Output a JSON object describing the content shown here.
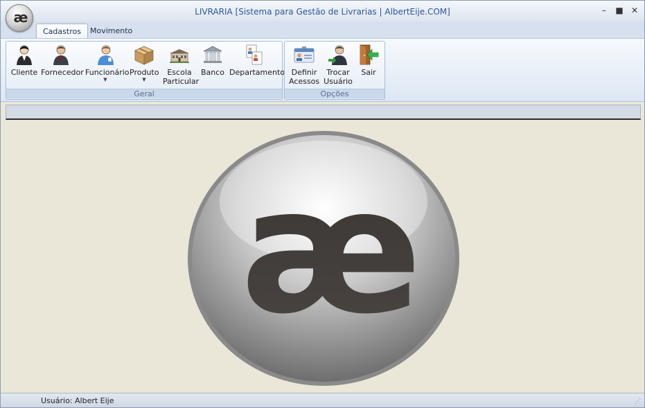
{
  "window": {
    "title": "LIVRARIA [Sistema para Gestão de Livrarias  |  AlbertEije.COM]",
    "app_button_text": "æ",
    "controls": {
      "minimize": "–",
      "restore": "■",
      "close": "✕"
    }
  },
  "tabs": [
    {
      "label": "Cadastros",
      "active": true
    },
    {
      "label": "Movimento",
      "active": false
    }
  ],
  "ribbon": {
    "groups": [
      {
        "label": "Geral",
        "buttons": [
          {
            "label": "Cliente",
            "icon": "client-person-icon"
          },
          {
            "label": "Fornecedor",
            "icon": "supplier-person-icon"
          },
          {
            "label": "Funcionário",
            "icon": "employee-person-icon",
            "dropdown": true
          },
          {
            "label": "Produto",
            "icon": "product-box-icon",
            "dropdown": true
          },
          {
            "label": "Escola Particular",
            "line1": "Escola",
            "line2": "Particular",
            "icon": "school-building-icon"
          },
          {
            "label": "Banco",
            "icon": "bank-building-icon"
          },
          {
            "label": "Departamento",
            "icon": "department-docs-icon"
          }
        ]
      },
      {
        "label": "Opções",
        "buttons": [
          {
            "label": "Definir Acessos",
            "line1": "Definir",
            "line2": "Acessos",
            "icon": "id-card-icon"
          },
          {
            "label": "Trocar Usuário",
            "line1": "Trocar",
            "line2": "Usuário",
            "icon": "switch-user-icon"
          },
          {
            "label": "Sair",
            "icon": "exit-door-icon"
          }
        ]
      }
    ]
  },
  "logo": {
    "text": "æ"
  },
  "status": {
    "user": "Usuário: Albert Eije"
  },
  "colors": {
    "title": "#2b55a0",
    "background": "#ebe7d8",
    "ribbon": "#dde7f3"
  }
}
